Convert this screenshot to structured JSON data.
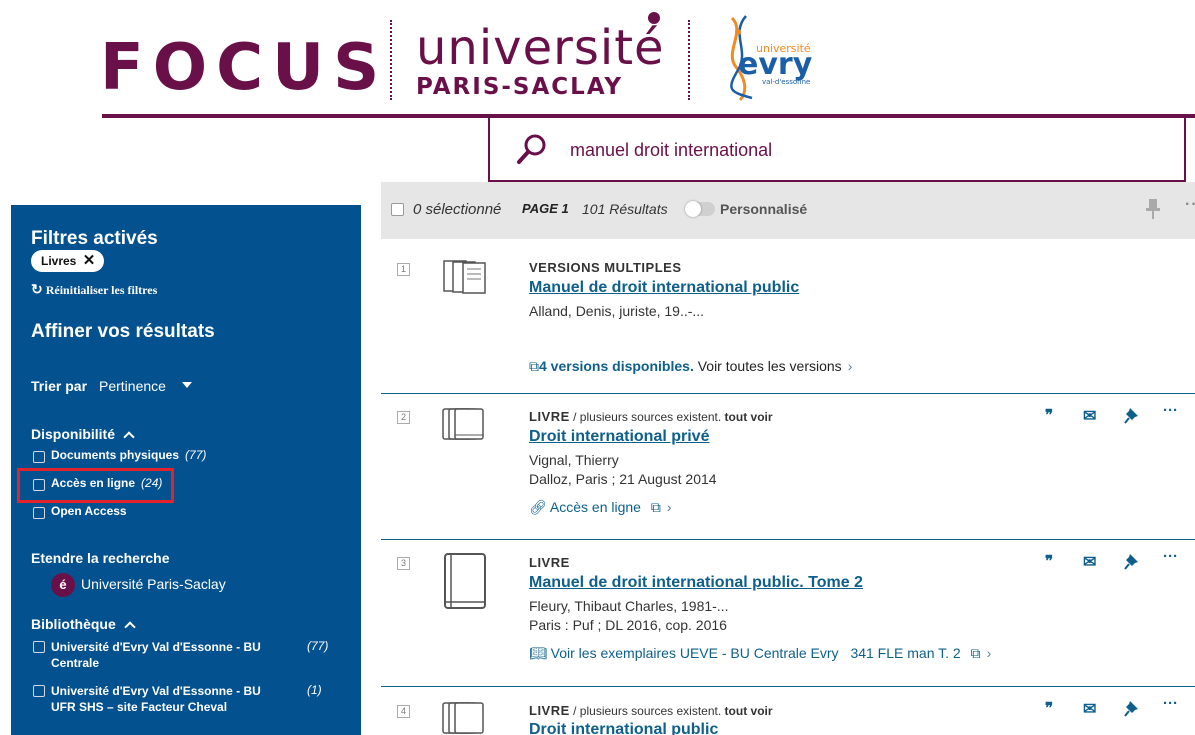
{
  "header": {
    "focus_logo": "FOCUS",
    "ups_logo_line1": "université",
    "ups_logo_line2": "PARIS-SACLAY",
    "evry_logo_top": "université",
    "evry_logo_main": "evry",
    "evry_logo_sub": "val-d'essonne",
    "brand_color": "#6a1049"
  },
  "search": {
    "value": "manuel droit international",
    "icon": "search-icon"
  },
  "sidebar": {
    "active_filters_title": "Filtres activés",
    "active_chip": "Livres",
    "chip_close": "✕",
    "reset_label": "Réinitialiser les filtres",
    "refine_title": "Affiner vos résultats",
    "sort_label": "Trier par",
    "sort_value": "Pertinence",
    "availability_title": "Disponibilité",
    "availability": [
      {
        "label": "Documents physiques",
        "count": "(77)"
      },
      {
        "label": "Accès en ligne",
        "count": "(24)"
      },
      {
        "label": "Open Access",
        "count": ""
      }
    ],
    "extend_title": "Etendre la recherche",
    "extend_item": "Université Paris-Saclay",
    "extend_avatar": "é",
    "library_title": "Bibliothèque",
    "libraries": [
      {
        "label": "Université d'Evry Val d'Essonne - BU Centrale",
        "count": "(77)"
      },
      {
        "label": "Université d'Evry Val d'Essonne - BU UFR SHS – site Facteur Cheval",
        "count": "(1)"
      }
    ],
    "background_color": "#03518f"
  },
  "results_bar": {
    "selected": "0 sélectionné",
    "page": "PAGE 1",
    "results": "101 Résultats",
    "personalize": "Personnalisé",
    "more": "···"
  },
  "results": [
    {
      "num": "1",
      "type": "VERSIONS MULTIPLES",
      "title": "Manuel de droit international public",
      "author": "Alland, Denis, juriste, 19..-...",
      "versions_link": "4 versions disponibles.",
      "versions_link_rest": " Voir toutes les versions",
      "thumb_icon": "multiple-versions-icon"
    },
    {
      "num": "2",
      "type": "LIVRE",
      "source_note": " / plusieurs sources existent.",
      "source_link": " tout voir",
      "title": "Droit international privé",
      "author": "Vignal, Thierry",
      "publisher": "Dalloz, Paris ; 21 August 2014",
      "online_link": "Accès en ligne",
      "thumb_icon": "books-icon"
    },
    {
      "num": "3",
      "type": "LIVRE",
      "title": "Manuel de droit international public. Tome 2",
      "author": "Fleury, Thibaut Charles, 1981-...",
      "publisher": "Paris : Puf ; DL 2016, cop. 2016",
      "holding_link": "Voir les exemplaires UEVE - BU Centrale Evry",
      "call_number": "341 FLE man T. 2",
      "thumb_icon": "book-icon"
    },
    {
      "num": "4",
      "type": "LIVRE",
      "source_note": " / plusieurs sources existent.",
      "source_link": " tout voir",
      "title": "Droit international public",
      "thumb_icon": "books-icon"
    }
  ],
  "actions": {
    "cite": "❞",
    "email": "✉",
    "more": "···"
  }
}
